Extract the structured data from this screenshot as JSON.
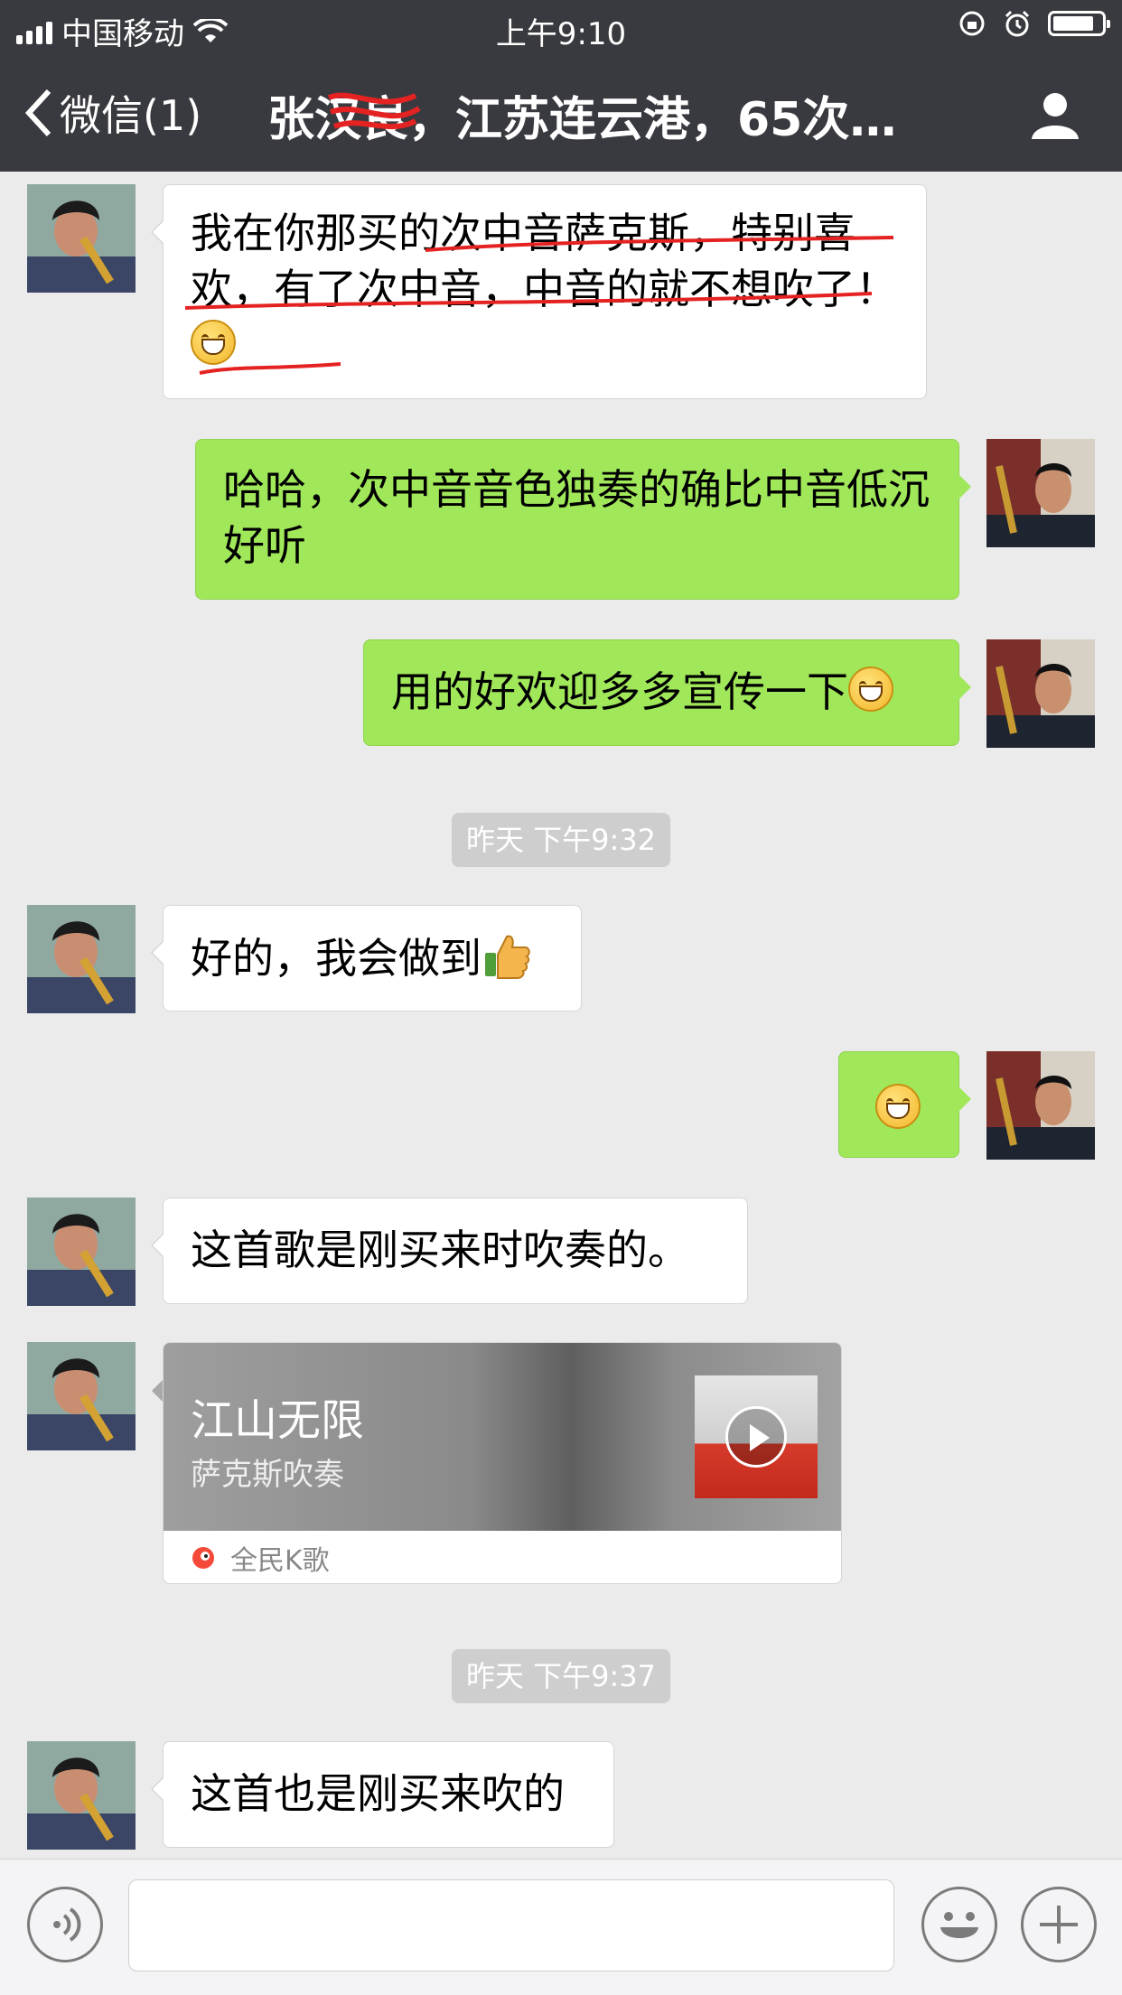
{
  "status_bar": {
    "carrier": "中国移动",
    "time": "上午9:10"
  },
  "nav": {
    "back_label": "微信(1)",
    "title": "张汉良，江苏连云港，65次…"
  },
  "messages": [
    {
      "side": "in",
      "text": "我在你那买的次中音萨克斯，特别喜欢，有了次中音，中音的就不想吹了！"
    },
    {
      "side": "out",
      "text": "哈哈，次中音音色独奏的确比中音低沉好听"
    },
    {
      "side": "out",
      "text": "用的好欢迎多多宣传一下"
    },
    {
      "side": "in",
      "text": "好的，我会做到"
    },
    {
      "side": "out",
      "text": ""
    },
    {
      "side": "in",
      "text": "这首歌是刚买来时吹奏的。"
    },
    {
      "side": "in",
      "text": "这首也是刚买来吹的"
    }
  ],
  "timestamps": [
    "昨天 下午9:32",
    "昨天 下午9:37"
  ],
  "music_card": {
    "title": "江山无限",
    "subtitle": "萨克斯吹奏",
    "source": "全民K歌"
  },
  "input_bar": {
    "placeholder": ""
  },
  "colors": {
    "nav_bg": "#393a3f",
    "outgoing_bubble": "#a0e75a",
    "incoming_bubble": "#ffffff",
    "chat_bg": "#ebebeb"
  }
}
